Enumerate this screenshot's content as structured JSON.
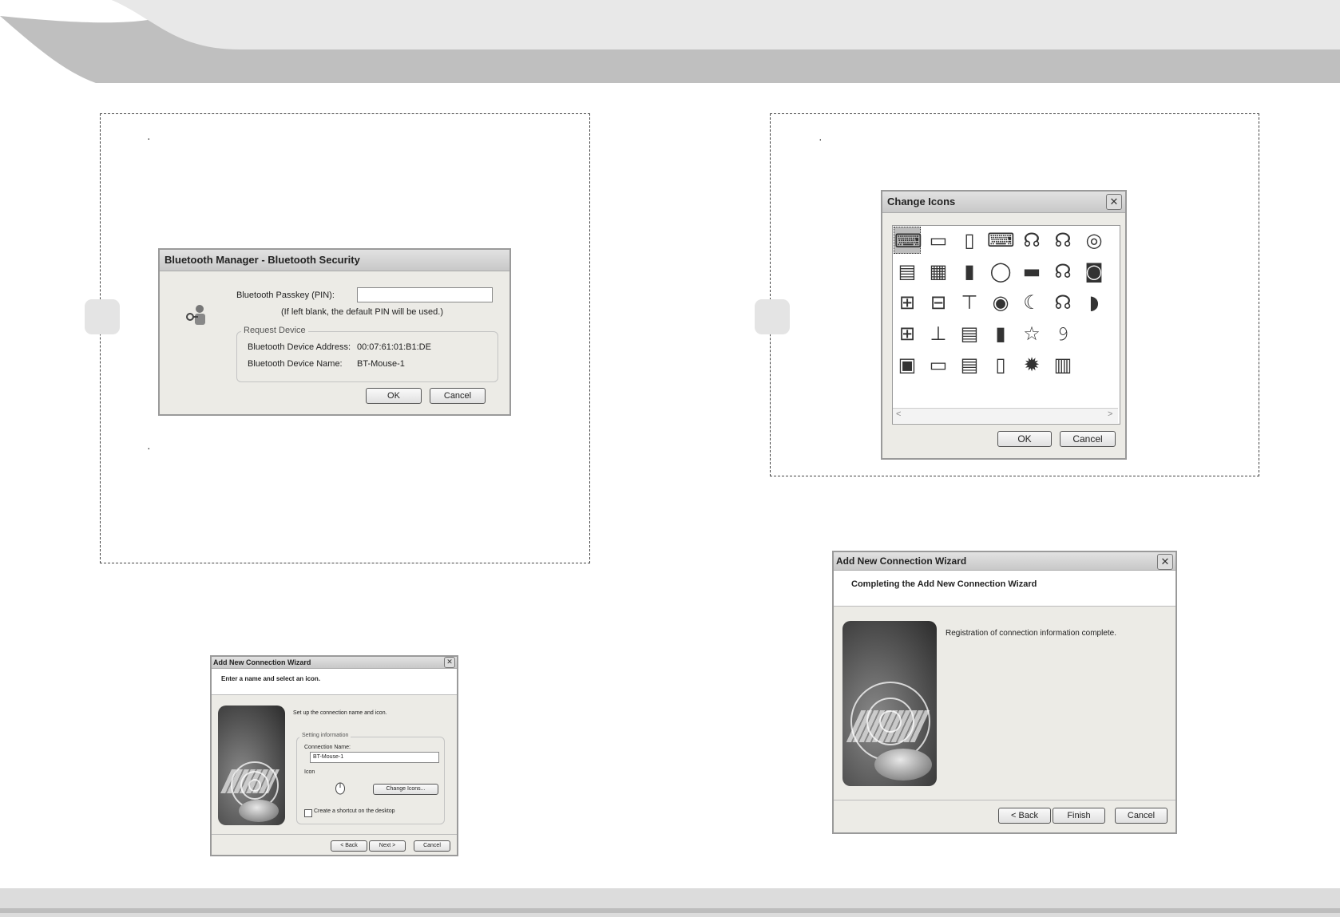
{
  "bt_security": {
    "title": "Bluetooth Manager - Bluetooth Security",
    "passkey_label": "Bluetooth Passkey (PIN):",
    "passkey_value": "",
    "hint": "(If left blank, the default PIN will be used.)",
    "group_label": "Request Device",
    "address_label": "Bluetooth Device Address:",
    "address_value": "00:07:61:01:B1:DE",
    "name_label": "Bluetooth Device Name:",
    "name_value": "BT-Mouse-1",
    "ok": "OK",
    "cancel": "Cancel",
    "icon": "key-person-icon"
  },
  "change_icons": {
    "title": "Change Icons",
    "close": "✕",
    "ok": "OK",
    "cancel": "Cancel",
    "scroll_left": "<",
    "scroll_right": ">",
    "icons": [
      [
        "keyboard-mouse-icon",
        "printer-icon",
        "pda-icon",
        "keyboard-icon",
        "headset-icon",
        "headphones-icon",
        "cd-stack-icon"
      ],
      [
        "laptop-icon",
        "network-computer-icon",
        "mobile-phone-icon",
        "mouse-icon",
        "scanner-icon",
        "headset-mic-icon",
        "speaker-icon"
      ],
      [
        "lan-icon",
        "network-icon",
        "fax-icon",
        "toggle-icon",
        "moon-icon",
        "headphones-icon",
        "glove-icon"
      ],
      [
        "network-tree-icon",
        "pipe-icon",
        "printer-icon",
        "phone-icon",
        "star-icon",
        "ear-icon"
      ],
      [
        "fax-machine-icon",
        "notebook-icon",
        "inkjet-printer-icon",
        "handset-icon",
        "sun-burst-icon",
        "computers-icon"
      ]
    ],
    "glyphs": [
      [
        "⌨",
        "▭",
        "▯",
        "⌨",
        "☊",
        "☊",
        "◎"
      ],
      [
        "▤",
        "▦",
        "▮",
        "◯",
        "▬",
        "☊",
        "◙"
      ],
      [
        "⊞",
        "⊟",
        "⊤",
        "◉",
        "☾",
        "☊",
        "◗"
      ],
      [
        "⊞",
        "⊥",
        "▤",
        "▮",
        "☆",
        "𝟿"
      ],
      [
        "▣",
        "▭",
        "▤",
        "▯",
        "✹",
        "▥"
      ]
    ]
  },
  "wizard_small": {
    "title": "Add New Connection Wizard",
    "close": "✕",
    "heading": "Enter a name and select an icon.",
    "intro": "Set up the connection name and icon.",
    "group_label": "Setting information",
    "conn_name_label": "Connection Name:",
    "conn_name_value": "BT-Mouse-1",
    "icon_label": "Icon",
    "change_icons_button": "Change Icons...",
    "shortcut_label": "Create a shortcut on the desktop",
    "back": "< Back",
    "next": "Next >",
    "cancel": "Cancel"
  },
  "wizard_large": {
    "title": "Add New Connection Wizard",
    "close": "✕",
    "heading": "Completing the Add New Connection Wizard",
    "message": "Registration of connection information complete.",
    "back": "< Back",
    "finish": "Finish",
    "cancel": "Cancel"
  },
  "bullets": {
    "p1_a": "·",
    "p1_b": "·",
    "p2_a": "·"
  }
}
